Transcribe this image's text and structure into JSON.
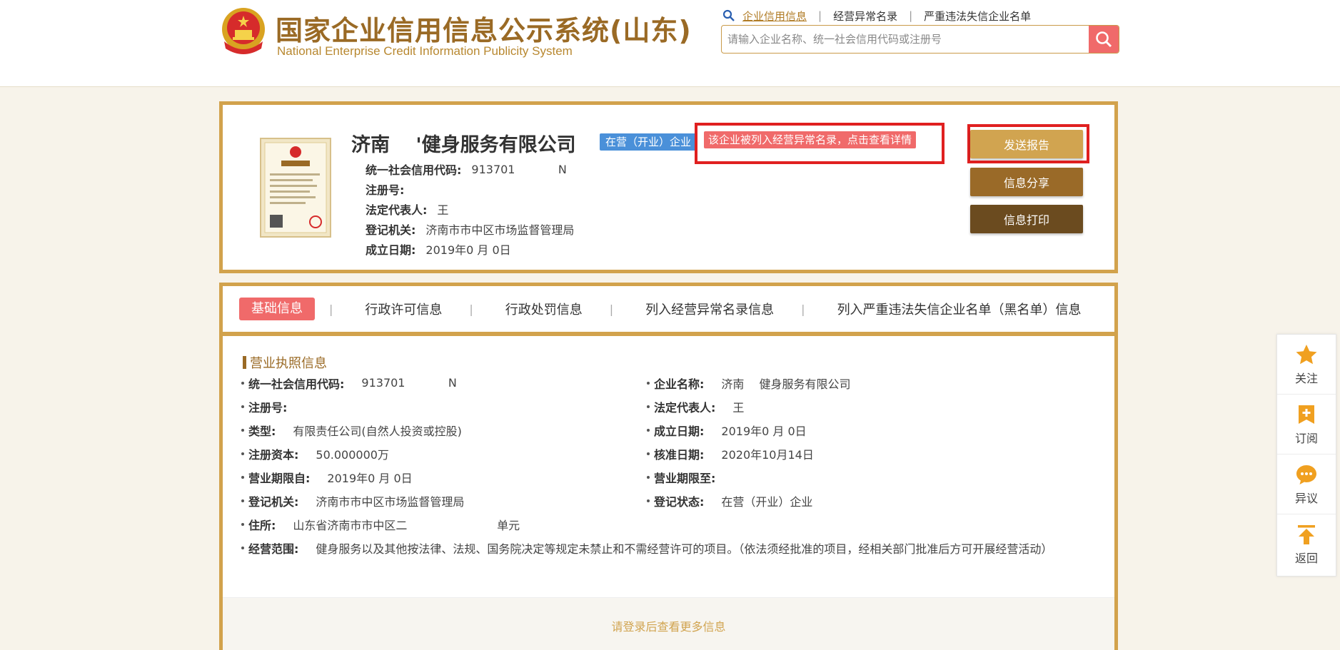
{
  "header": {
    "title": "国家企业信用信息公示系统(山东)",
    "subtitle": "National Enterprise Credit Information Publicity System",
    "nav": [
      "企业信用信息",
      "经营异常名录",
      "严重违法失信企业名单"
    ],
    "search_placeholder": "请输入企业名称、统一社会信用代码或注册号"
  },
  "company": {
    "name": "济南   '健身服务有限公司",
    "status_tag": "在营（开业）企业",
    "abnormal_tag": "该企业被列入经营异常名录，点击查看详情",
    "rows": [
      {
        "label": "统一社会信用代码:",
        "value": "913701         N"
      },
      {
        "label": "注册号:",
        "value": ""
      },
      {
        "label": "法定代表人:",
        "value": "王"
      },
      {
        "label": "登记机关:",
        "value": "济南市市中区市场监督管理局"
      },
      {
        "label": "成立日期:",
        "value": "2019年0 月 0日"
      }
    ],
    "buttons": {
      "send": "发送报告",
      "share": "信息分享",
      "print": "信息打印"
    }
  },
  "tabs": [
    "基础信息",
    "行政许可信息",
    "行政处罚信息",
    "列入经营异常名录信息",
    "列入严重违法失信企业名单（黑名单）信息"
  ],
  "section_title": "营业执照信息",
  "fields": {
    "left": [
      {
        "label": "统一社会信用代码:",
        "value": "913701         N"
      },
      {
        "label": "注册号:",
        "value": ""
      },
      {
        "label": "类型:",
        "value": "有限责任公司(自然人投资或控股)"
      },
      {
        "label": "注册资本:",
        "value": "50.000000万"
      },
      {
        "label": "营业期限自:",
        "value": "2019年0 月 0日"
      },
      {
        "label": "登记机关:",
        "value": "济南市市中区市场监督管理局"
      },
      {
        "label": "住所:",
        "value": "山东省济南市市中区二                   单元"
      },
      {
        "label": "经营范围:",
        "value": "健身服务以及其他按法律、法规、国务院决定等规定未禁止和不需经营许可的项目。（依法须经批准的项目，经相关部门批准后方可开展经营活动）"
      }
    ],
    "right": [
      {
        "label": "企业名称:",
        "value": "济南   健身服务有限公司"
      },
      {
        "label": "法定代表人:",
        "value": "王"
      },
      {
        "label": "成立日期:",
        "value": "2019年0 月 0日"
      },
      {
        "label": "核准日期:",
        "value": "2020年10月14日"
      },
      {
        "label": "营业期限至:",
        "value": ""
      },
      {
        "label": "登记状态:",
        "value": "在营（开业）企业"
      }
    ]
  },
  "login_text": "请登录后查看更多信息",
  "sidebar": [
    "关注",
    "订阅",
    "异议",
    "返回"
  ],
  "colors": {
    "gold": "#d2a24c",
    "brown": "#9a6a25",
    "red": "#f06a6a",
    "blue": "#4a90d9",
    "alert": "#e02020"
  }
}
